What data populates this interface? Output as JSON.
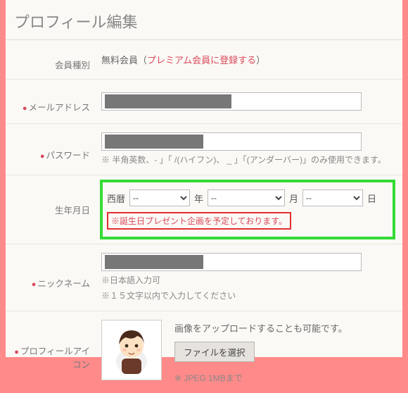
{
  "heading": "プロフィール編集",
  "labels": {
    "member_type": "会員種別",
    "email": "メールアドレス",
    "password": "パスワード",
    "birthdate": "生年月日",
    "nickname": "ニックネーム",
    "avatar": "プロフィールアイコン"
  },
  "member_type": {
    "value": "無料会員",
    "premium_link": "プレミアム会員に登録する",
    "open_paren": "（",
    "close_paren": "）"
  },
  "password": {
    "note": "※ 半角英数、-  」「 /(ハイフン)、 _  」「(アンダーバー)」のみ使用できます。"
  },
  "birthdate": {
    "era_label": "西暦",
    "year_unit": "年",
    "month_unit": "月",
    "day_unit": "日",
    "placeholder": "--",
    "notice": "※誕生日プレゼント企画を予定しております。"
  },
  "nickname": {
    "note1": "※日本語入力可",
    "note2": "※１５文字以内で入力してください"
  },
  "avatar": {
    "upload_text": "画像をアップロードすることも可能です。",
    "button": "ファイルを選択",
    "note": "※ JPEG 1MBまで"
  }
}
